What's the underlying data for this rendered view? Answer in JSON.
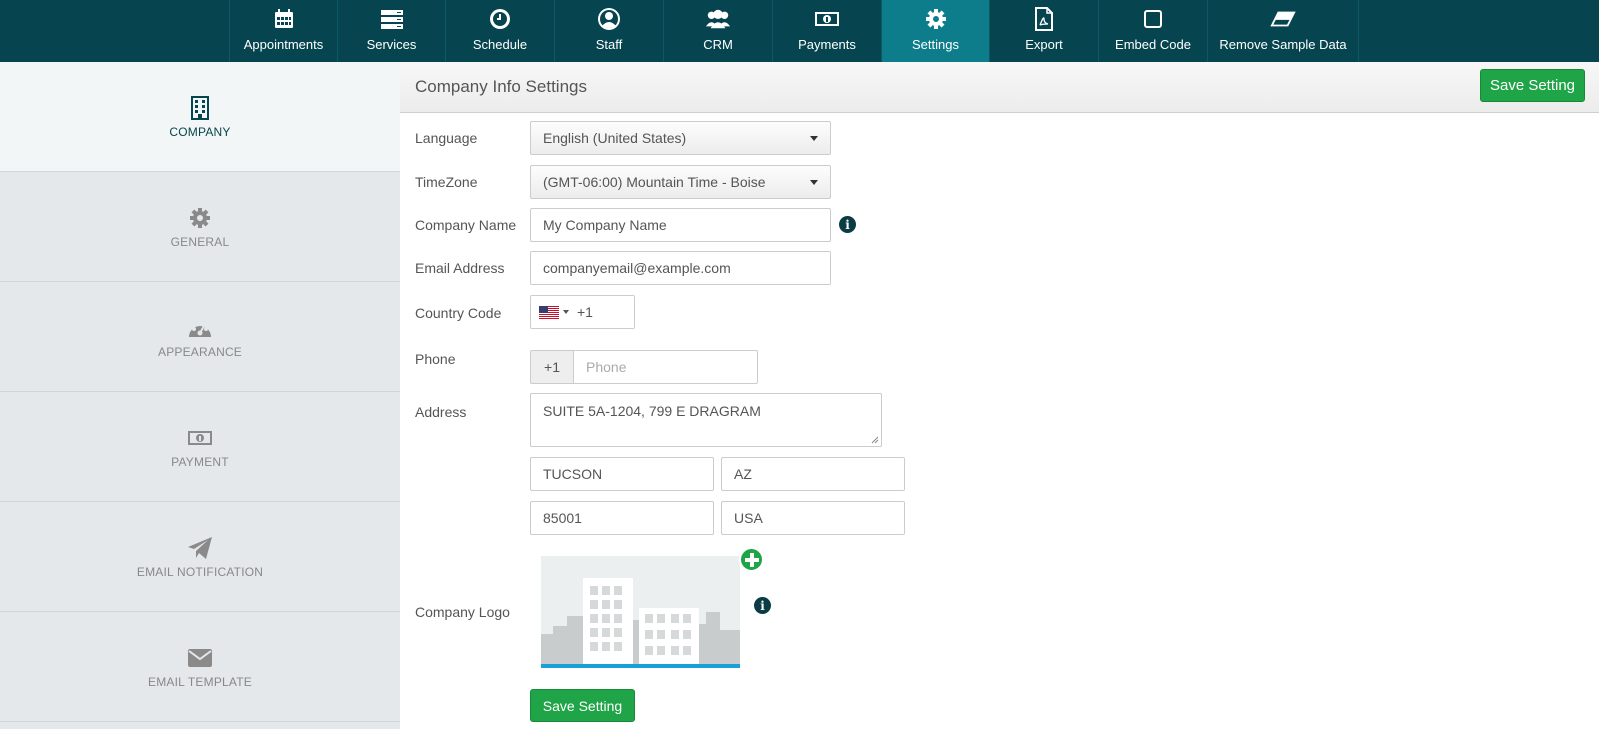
{
  "nav": {
    "items": [
      {
        "label": "Appointments",
        "icon": "calendar-icon",
        "active": false
      },
      {
        "label": "Services",
        "icon": "list-icon",
        "active": false
      },
      {
        "label": "Schedule",
        "icon": "clock-icon",
        "active": false
      },
      {
        "label": "Staff",
        "icon": "user-icon",
        "active": false
      },
      {
        "label": "CRM",
        "icon": "users-icon",
        "active": false
      },
      {
        "label": "Payments",
        "icon": "money-icon",
        "active": false
      },
      {
        "label": "Settings",
        "icon": "gear-icon",
        "active": true
      },
      {
        "label": "Export",
        "icon": "pdf-icon",
        "active": false
      },
      {
        "label": "Embed Code",
        "icon": "square-icon",
        "active": false
      },
      {
        "label": "Remove Sample Data",
        "icon": "eraser-icon",
        "active": false
      }
    ]
  },
  "sidebar": {
    "items": [
      {
        "label": "COMPANY",
        "icon": "building-icon",
        "active": true
      },
      {
        "label": "GENERAL",
        "icon": "gear-icon",
        "active": false
      },
      {
        "label": "APPEARANCE",
        "icon": "palette-icon",
        "active": false
      },
      {
        "label": "PAYMENT",
        "icon": "money-icon",
        "active": false
      },
      {
        "label": "EMAIL NOTIFICATION",
        "icon": "paper-plane-icon",
        "active": false
      },
      {
        "label": "EMAIL TEMPLATE",
        "icon": "envelope-icon",
        "active": false
      }
    ]
  },
  "panel": {
    "title": "Company Info Settings",
    "save_label": "Save Setting"
  },
  "form": {
    "language": {
      "label": "Language",
      "value": "English (United States)"
    },
    "timezone": {
      "label": "TimeZone",
      "value": "(GMT-06:00) Mountain Time - Boise"
    },
    "company_name": {
      "label": "Company Name",
      "value": "My Company Name"
    },
    "email": {
      "label": "Email Address",
      "value": "companyemail@example.com"
    },
    "country_code": {
      "label": "Country Code",
      "value": "+1"
    },
    "phone": {
      "label": "Phone",
      "prefix": "+1",
      "placeholder": "Phone"
    },
    "address": {
      "label": "Address",
      "street": "SUITE 5A-1204, 799 E DRAGRAM",
      "city": "TUCSON",
      "state": "AZ",
      "zip": "85001",
      "country": "USA"
    },
    "logo": {
      "label": "Company Logo"
    },
    "save_label": "Save Setting"
  },
  "colors": {
    "nav_bg": "#06454f",
    "nav_active": "#0d7d8c",
    "save_green": "#1fa447"
  }
}
